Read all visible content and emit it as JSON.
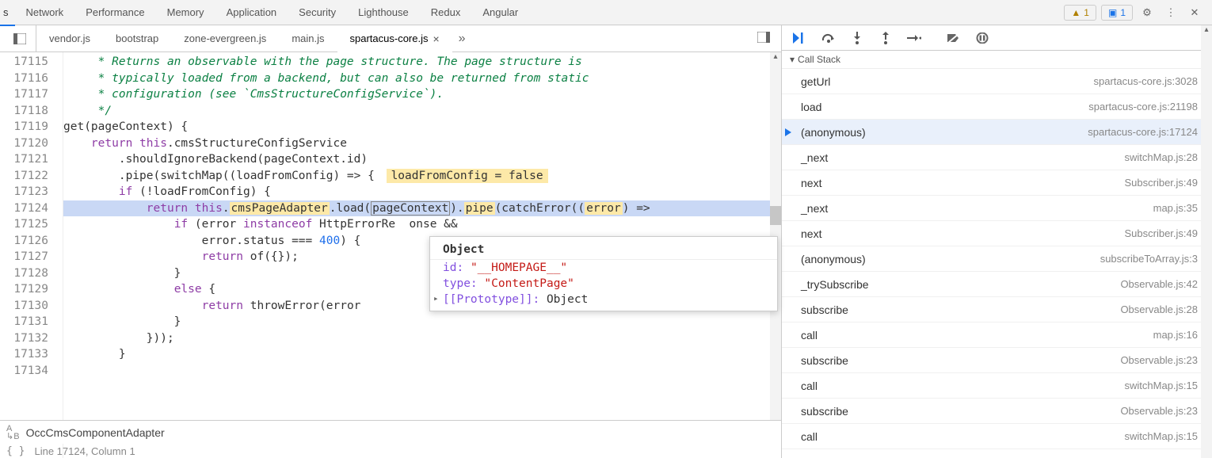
{
  "topTabs": [
    "s",
    "Network",
    "Performance",
    "Memory",
    "Application",
    "Security",
    "Lighthouse",
    "Redux",
    "Angular"
  ],
  "topBadges": {
    "warnCount": "1",
    "msgCount": "1"
  },
  "fileTabs": [
    "vendor.js",
    "bootstrap",
    "zone-evergreen.js",
    "main.js",
    "spartacus-core.js"
  ],
  "activeFileTabIndex": 4,
  "lineStart": 17115,
  "lineEnd": 17134,
  "highlightLine": 17124,
  "code": {
    "l17115": " * Returns an observable with the page structure. The page structure is",
    "l17116": " * typically loaded from a backend, but can also be returned from static",
    "l17117": " * configuration (see `CmsStructureConfigService`).",
    "l17118": " */",
    "l17119_pre": "get(pageContext) {",
    "l17120": "    return this.cmsStructureConfigService",
    "l17121": "        .shouldIgnoreBackend(pageContext.id)",
    "l17122_a": "        .pipe(switchMap((loadFromConfig) => {",
    "l17122_eval": "loadFromConfig = false",
    "l17123": "        if (!loadFromConfig) {",
    "l17124_a": "            return this.cmsPageAdapter.load(",
    "l17124_id": "pageContext",
    "l17124_b": ").pipe(catchError((error) => ",
    "l17125": "                if (error instanceof HttpErrorRe  onse &&",
    "l17126": "                    error.status === 400) {",
    "l17127": "                    return of({});",
    "l17128": "                }",
    "l17129": "                else {",
    "l17130": "                    return throwError(error",
    "l17131": "                }",
    "l17132": "            }));",
    "l17133": "        }",
    "l17134": ""
  },
  "tooltip": {
    "title": "Object",
    "rows": [
      {
        "key": "id:",
        "val": "\"__HOMEPAGE__\"",
        "valClass": "red"
      },
      {
        "key": "type:",
        "val": "\"ContentPage\"",
        "valClass": "red"
      },
      {
        "key": "[[Prototype]]:",
        "val": "Object",
        "keyClass": "purple",
        "expandable": true
      }
    ]
  },
  "searchValue": "OccCmsComponentAdapter",
  "callStackTitle": "Call Stack",
  "callStack": [
    {
      "fn": "getUrl",
      "src": "spartacus-core.js:3028"
    },
    {
      "fn": "load",
      "src": "spartacus-core.js:21198"
    },
    {
      "fn": "(anonymous)",
      "src": "spartacus-core.js:17124",
      "current": true
    },
    {
      "fn": "_next",
      "src": "switchMap.js:28"
    },
    {
      "fn": "next",
      "src": "Subscriber.js:49"
    },
    {
      "fn": "_next",
      "src": "map.js:35"
    },
    {
      "fn": "next",
      "src": "Subscriber.js:49"
    },
    {
      "fn": "(anonymous)",
      "src": "subscribeToArray.js:3"
    },
    {
      "fn": "_trySubscribe",
      "src": "Observable.js:42"
    },
    {
      "fn": "subscribe",
      "src": "Observable.js:28"
    },
    {
      "fn": "call",
      "src": "map.js:16"
    },
    {
      "fn": "subscribe",
      "src": "Observable.js:23"
    },
    {
      "fn": "call",
      "src": "switchMap.js:15"
    },
    {
      "fn": "subscribe",
      "src": "Observable.js:23"
    },
    {
      "fn": "call",
      "src": "switchMap.js:15"
    }
  ],
  "statusLine": "Line 17124, Column 1"
}
